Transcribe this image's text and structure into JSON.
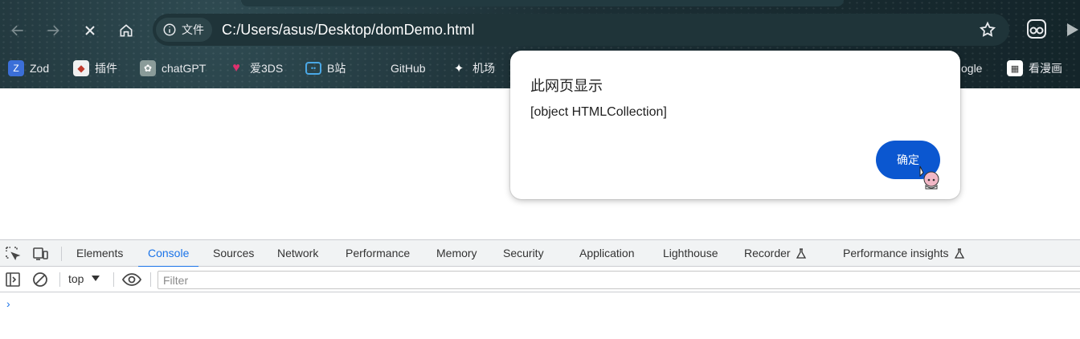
{
  "toolbar": {
    "site_chip_label": "文件",
    "url": "C:/Users/asus/Desktop/domDemo.html"
  },
  "bookmarks": [
    {
      "label": "Zod",
      "icon": "zod-icon"
    },
    {
      "label": "插件",
      "icon": "plugin-icon"
    },
    {
      "label": "chatGPT",
      "icon": "chatgpt-icon"
    },
    {
      "label": "爱3DS",
      "icon": "heart-icon"
    },
    {
      "label": "B站",
      "icon": "bilibili-icon"
    },
    {
      "label": "GitHub",
      "icon": "github-icon"
    },
    {
      "label": "机场",
      "icon": "sparkle-icon"
    },
    {
      "label": "ogle",
      "icon": "google-icon"
    },
    {
      "label": "看漫画",
      "icon": "comic-icon"
    }
  ],
  "dialog": {
    "title": "此网页显示",
    "message": "[object HTMLCollection]",
    "ok_label": "确定"
  },
  "devtools": {
    "tabs": [
      {
        "label": "Elements"
      },
      {
        "label": "Console"
      },
      {
        "label": "Sources"
      },
      {
        "label": "Network"
      },
      {
        "label": "Performance"
      },
      {
        "label": "Memory"
      },
      {
        "label": "Security"
      },
      {
        "label": "Application"
      },
      {
        "label": "Lighthouse"
      },
      {
        "label": "Recorder"
      },
      {
        "label": "Performance insights"
      }
    ],
    "active_tab": "Console",
    "context": "top",
    "filter_placeholder": "Filter",
    "prompt": "›"
  },
  "colors": {
    "accent": "#1a73e8",
    "dialog_button": "#0b57d0"
  }
}
